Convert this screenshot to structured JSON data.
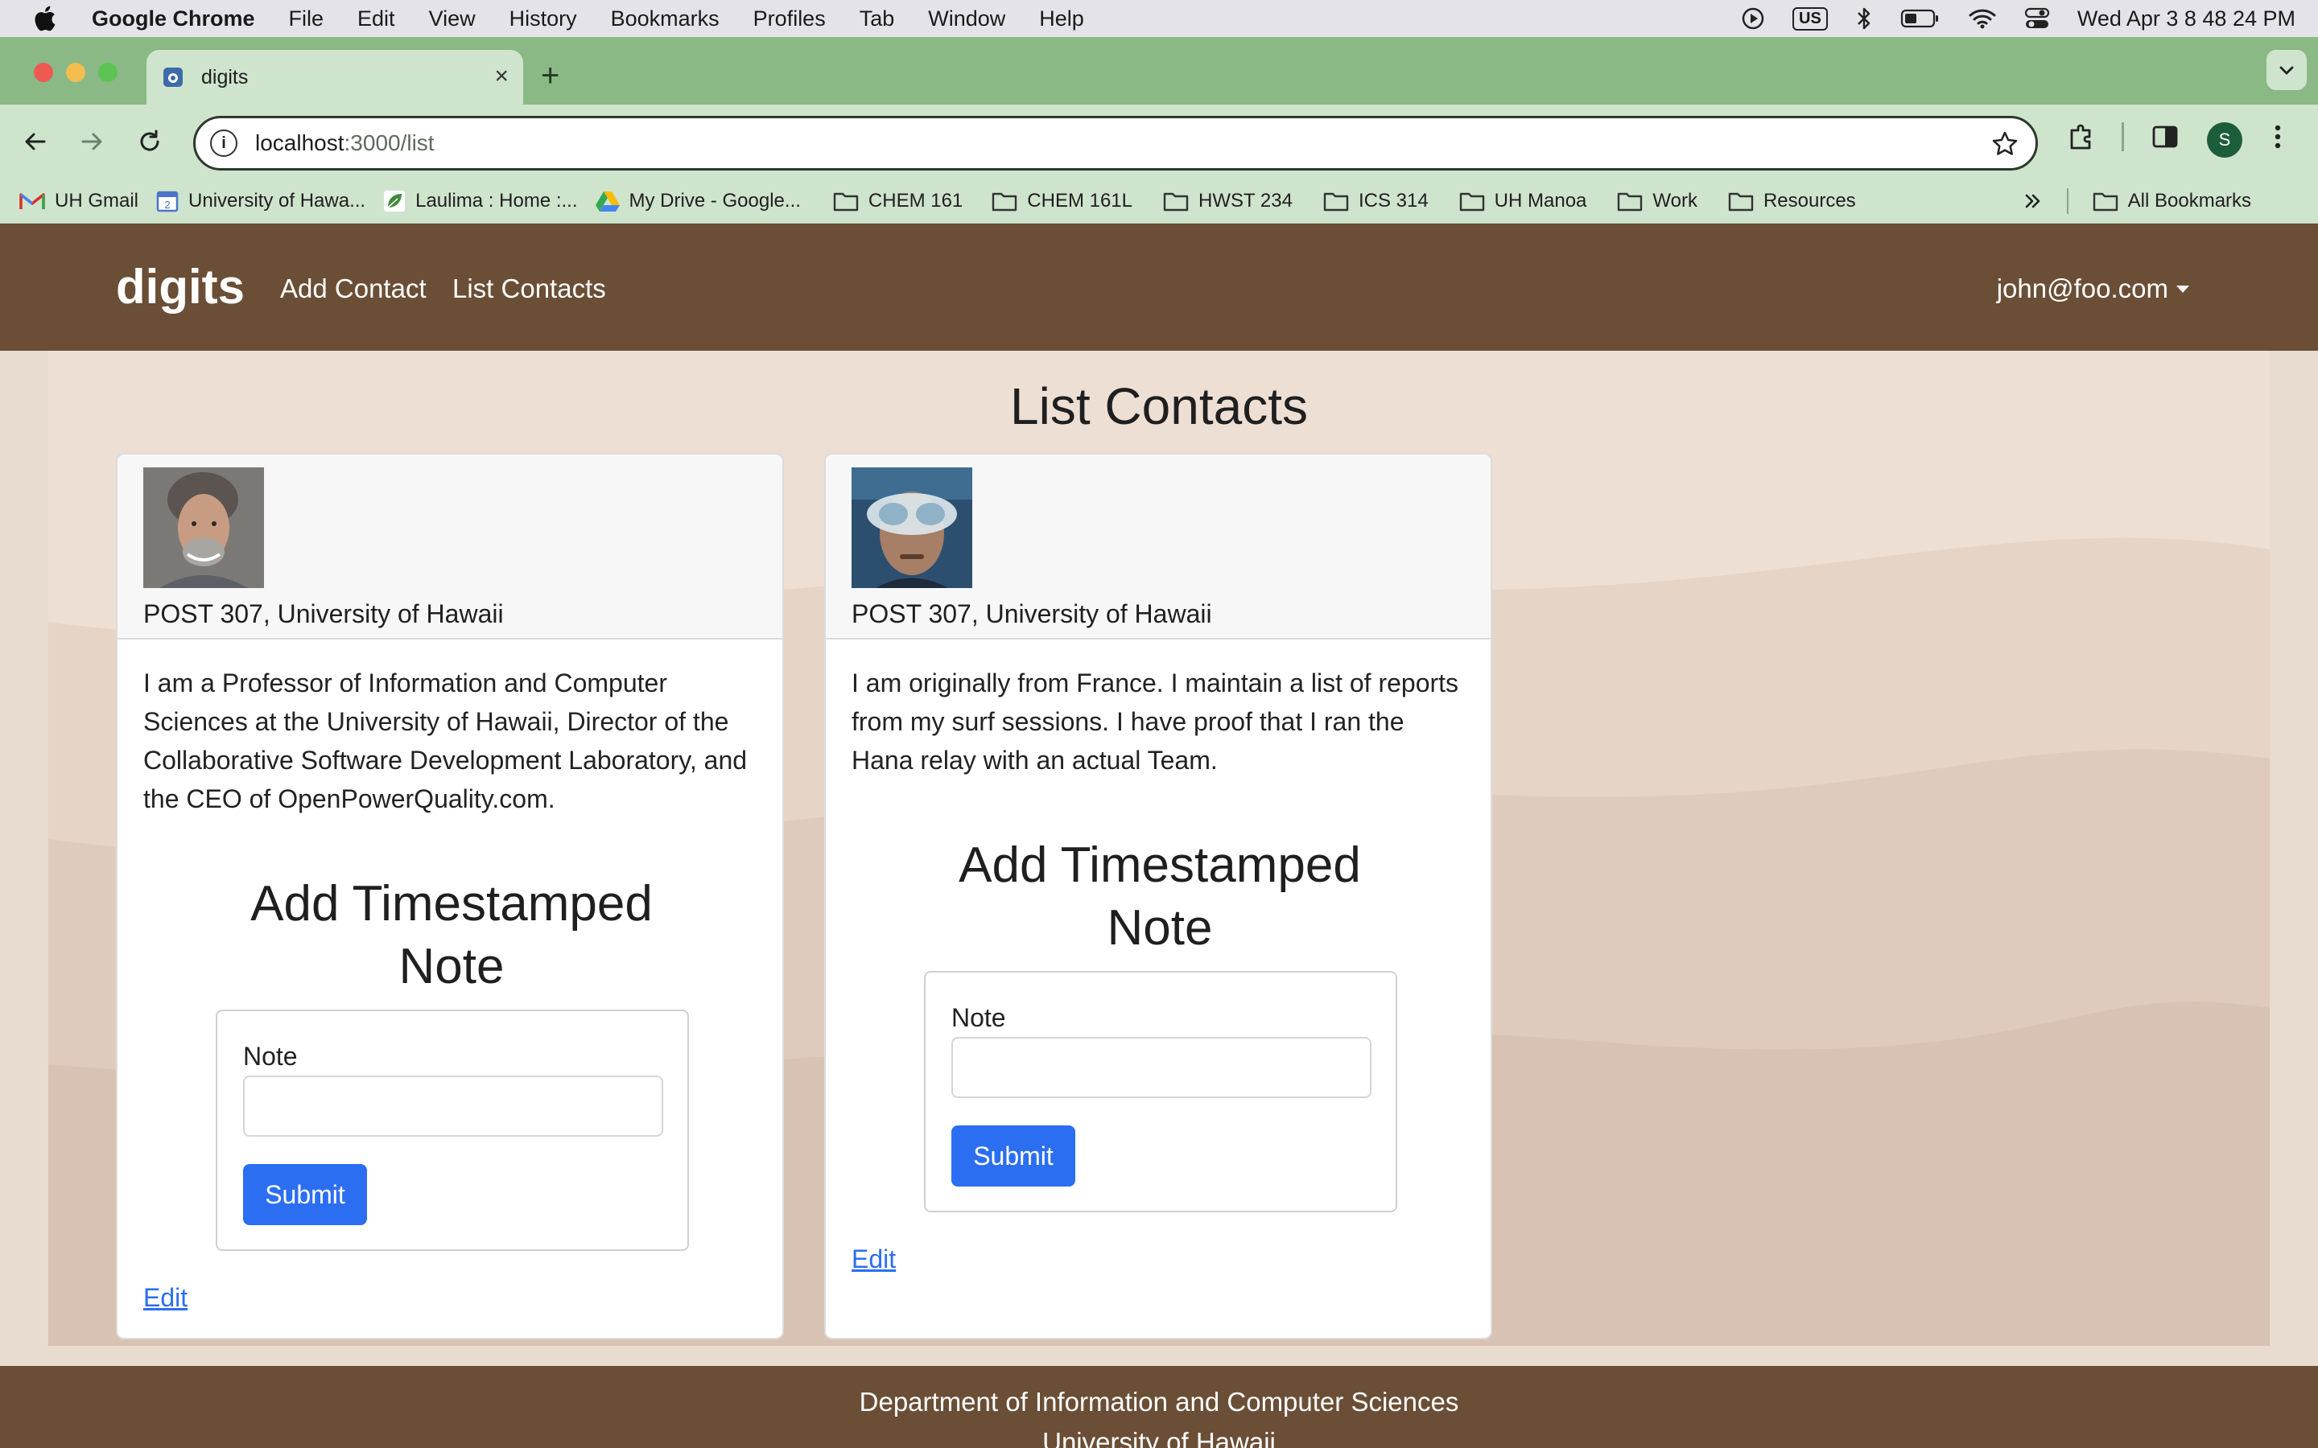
{
  "menubar": {
    "app_name": "Google Chrome",
    "items": [
      "File",
      "Edit",
      "View",
      "History",
      "Bookmarks",
      "Profiles",
      "Tab",
      "Window",
      "Help"
    ],
    "keyboard_layout": "US",
    "datetime": "Wed Apr 3  8 48 24 PM"
  },
  "browser": {
    "tab_title": "digits",
    "url_host": "localhost",
    "url_path": ":3000/list",
    "profile_initial": "S",
    "bookmarks": [
      "UH Gmail",
      "University of Hawa...",
      "Laulima : Home :...",
      "My Drive - Google...",
      "CHEM 161",
      "CHEM 161L",
      "HWST 234",
      "ICS 314",
      "UH Manoa",
      "Work",
      "Resources"
    ],
    "all_bookmarks": "All Bookmarks",
    "colors": {
      "frame": "#8ab986",
      "toolbar": "#cfe4cc"
    }
  },
  "navbar": {
    "brand": "digits",
    "links": [
      "Add Contact",
      "List Contacts"
    ],
    "user": "john@foo.com",
    "color": "#6b4e36"
  },
  "page": {
    "title": "List Contacts"
  },
  "contacts": [
    {
      "address": "POST 307, University of Hawaii",
      "description": "I am a Professor of Information and Computer Sciences at the University of Hawaii, Director of the Collaborative Software Development Laboratory, and the CEO of OpenPowerQuality.com.",
      "note_heading_line1": "Add Timestamped",
      "note_heading_line2": "Note",
      "note_label": "Note",
      "note_value": "",
      "submit_label": "Submit",
      "edit_label": "Edit"
    },
    {
      "address": "POST 307, University of Hawaii",
      "description": "I am originally from France. I maintain a list of reports from my surf sessions. I have proof that I ran the Hana relay with an actual Team.",
      "note_heading_line1": "Add Timestamped",
      "note_heading_line2": "Note",
      "note_label": "Note",
      "note_value": "",
      "submit_label": "Submit",
      "edit_label": "Edit"
    }
  ],
  "footer": {
    "line1": "Department of Information and Computer Sciences",
    "line2": "University of Hawaii"
  },
  "theme": {
    "accent": "#2b6ef2"
  }
}
